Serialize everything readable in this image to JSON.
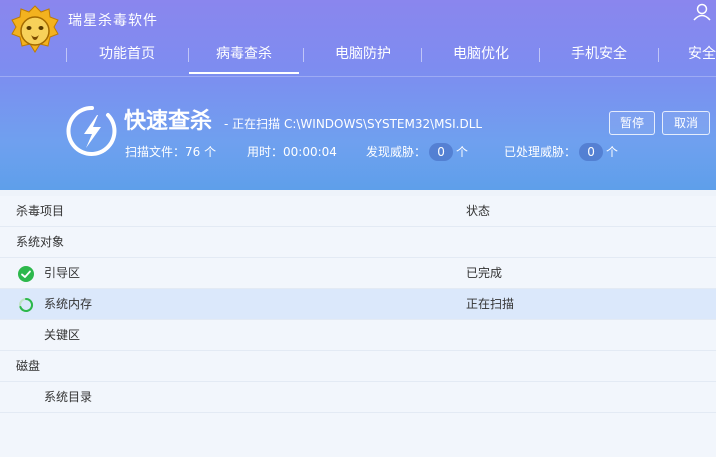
{
  "app": {
    "title": "瑞星杀毒软件"
  },
  "nav": {
    "items": [
      "功能首页",
      "病毒查杀",
      "电脑防护",
      "电脑优化",
      "手机安全",
      "安全"
    ],
    "active": "病毒查杀"
  },
  "scan": {
    "title": "快速查杀",
    "status_text": "- 正在扫描 C:\\WINDOWS\\SYSTEM32\\MSI.DLL",
    "scanned_files": "扫描文件：76 个",
    "elapsed": "用时：00:00:04",
    "threats_label": "发现威胁：",
    "threats_count": "0",
    "handled_label": "已处理威胁：",
    "handled_count": "0",
    "unit": "个",
    "pause_button": "暂停",
    "cancel_button": "取消"
  },
  "table": {
    "header": {
      "item": "杀毒项目",
      "status": "状态"
    },
    "rows": [
      {
        "label": "系统对象",
        "status": ""
      },
      {
        "label": "引导区",
        "status": "已完成"
      },
      {
        "label": "系统内存",
        "status": "正在扫描"
      },
      {
        "label": "关键区",
        "status": ""
      },
      {
        "label": "磁盘",
        "status": ""
      },
      {
        "label": "系统目录",
        "status": ""
      }
    ]
  },
  "colors": {
    "accent": "#7e8cf0",
    "done_green": "#2db84c",
    "highlight_row": "#dbe8fb"
  },
  "icons": {
    "logo": "lion-logo-icon",
    "user": "user-icon",
    "scan": "lightning-icon",
    "done": "check-circle-icon",
    "loading": "spinner-icon"
  }
}
